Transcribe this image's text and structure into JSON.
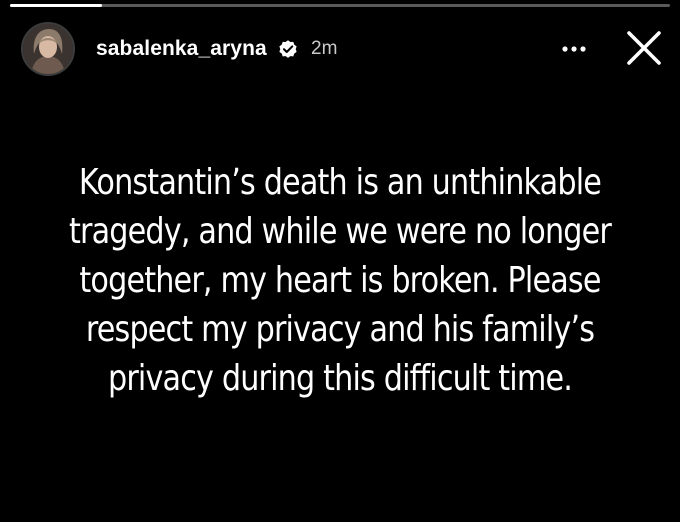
{
  "story": {
    "progress": 0.14,
    "user": {
      "username": "sabalenka_aryna",
      "verified": true,
      "posted_ago": "2m",
      "avatar_icon": "user-avatar"
    },
    "actions": {
      "more_icon": "more-horizontal-icon",
      "close_icon": "close-icon"
    },
    "text_lines": [
      "Konstantin’s death is an unthinkable",
      "tragedy, and while we were no longer",
      "together, my heart is broken. Please",
      "respect my privacy and his family’s",
      "privacy during this difficult time."
    ]
  },
  "colors": {
    "background": "#000000",
    "text": "#ffffff",
    "secondary_text": "#c9c9c9",
    "progress_track": "#5a5a5a"
  }
}
